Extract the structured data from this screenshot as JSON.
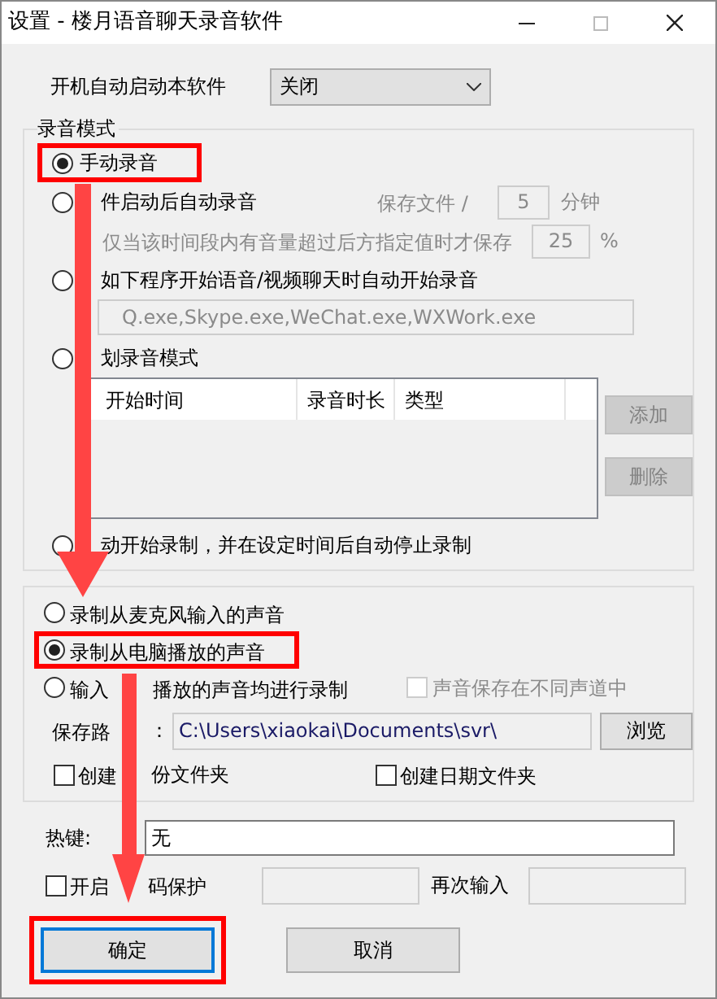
{
  "window": {
    "title": "设置 - 楼月语音聊天录音软件"
  },
  "startup": {
    "label": "开机自动启动本软件",
    "value": "关闭"
  },
  "record_mode": {
    "legend": "录音模式",
    "manual": {
      "label": "手动录音",
      "selected": true,
      "highlighted": true
    },
    "auto_start": {
      "label": "件启动后自动录音",
      "selected": false
    },
    "save_file": {
      "label": "保存文件 /",
      "value": "5",
      "unit": "分钟",
      "disabled": true
    },
    "threshold": {
      "label": "仅当该时间段内有音量超过后方指定值时才保存",
      "value": "25",
      "unit": "%",
      "disabled": true
    },
    "programs": {
      "label": "如下程序开始语音/视频聊天时自动开始录音",
      "selected": false
    },
    "programs_field": {
      "value": "Q.exe,Skype.exe,WeChat.exe,WXWork.exe",
      "disabled": true
    },
    "schedule": {
      "label": "划录音模式",
      "selected": false
    },
    "schedule_table": {
      "columns": [
        "开始时间",
        "录音时长",
        "类型"
      ]
    },
    "schedule_buttons": [
      {
        "label": "添加",
        "disabled": true
      },
      {
        "label": "删除",
        "disabled": true
      }
    ],
    "timed": {
      "label": "动开始录制，并在设定时间后自动停止录制",
      "selected": false
    }
  },
  "source": {
    "options": [
      {
        "label": "录制从麦克风输入的声音",
        "selected": false,
        "highlighted": false
      },
      {
        "label": "录制从电脑播放的声音",
        "selected": true,
        "highlighted": true
      },
      {
        "label": "输入",
        "label_2": "播放的声音均进行录制",
        "selected": false,
        "highlighted": false
      }
    ],
    "channels": {
      "label": "声音保存在不同声道中",
      "checked": false,
      "disabled": true
    },
    "save_path": {
      "label": "保存路",
      "label_2": "：",
      "value": "C:\\Users\\xiaokai\\Documents\\svr\\",
      "button": "浏览"
    },
    "folders": [
      {
        "label": "创建",
        "label_2": "份文件夹",
        "checked": false
      },
      {
        "label": "创建日期文件夹",
        "checked": false
      }
    ]
  },
  "hotkey": {
    "label": "热键:",
    "value": "无"
  },
  "password": {
    "label": "开启",
    "label_2": "码保护",
    "checked": false,
    "repeat_label": "再次输入"
  },
  "buttons": [
    {
      "label": "确定",
      "highlighted": true,
      "focused": true
    },
    {
      "label": "取消",
      "highlighted": false,
      "focused": false
    }
  ]
}
